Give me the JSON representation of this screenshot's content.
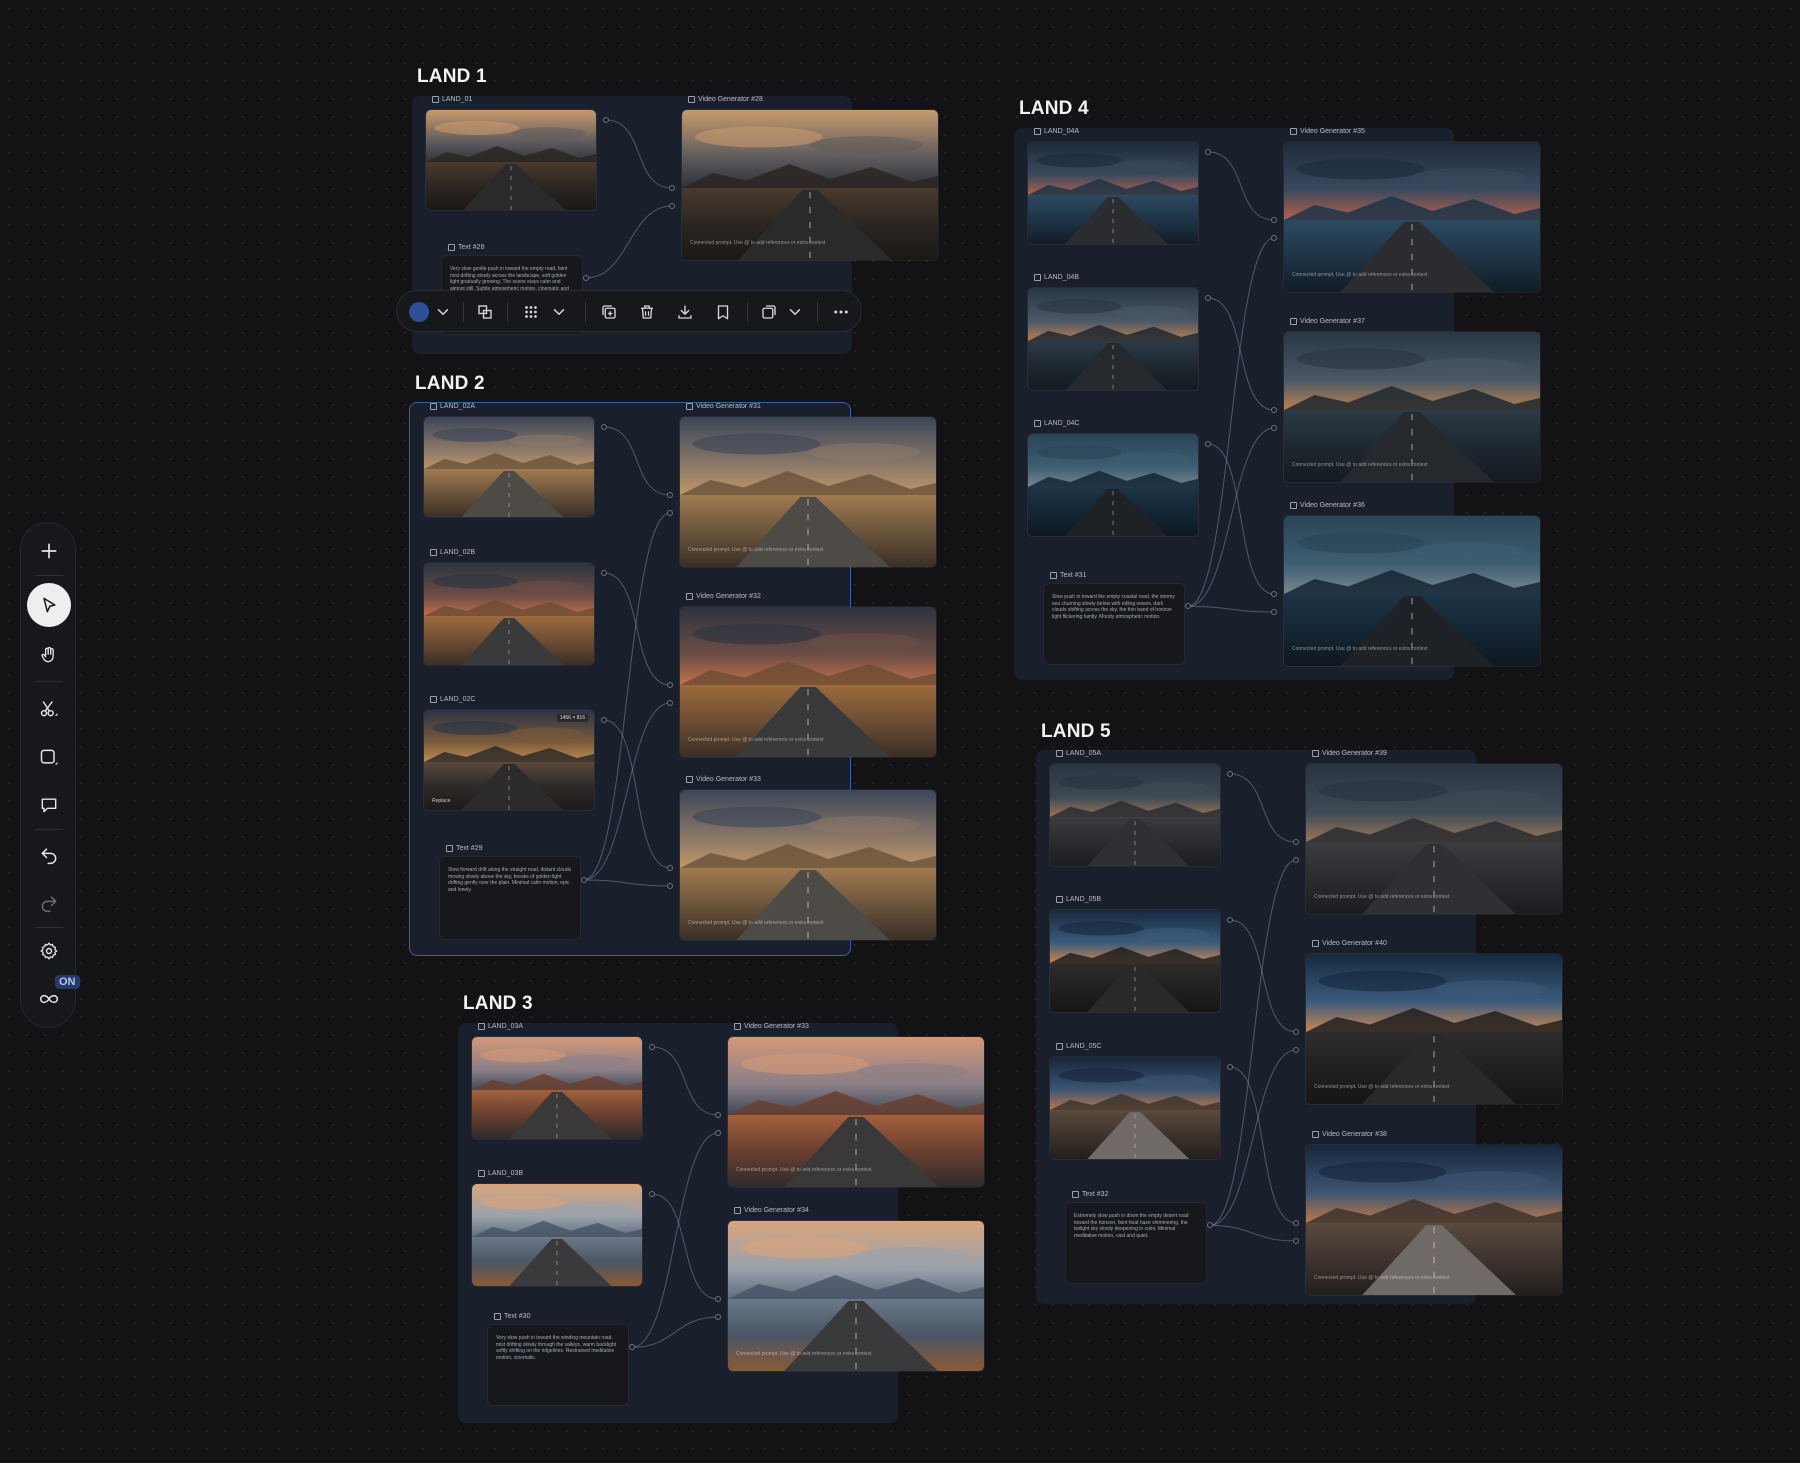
{
  "canvas": {
    "groups": [
      {
        "id": "land1",
        "title": "LAND 1",
        "selected": false,
        "nodes": [
          {
            "id": "l1-img-a",
            "kind": "image",
            "label": "LAND_01",
            "palette": "dusk-road"
          },
          {
            "id": "l1-vid",
            "kind": "video",
            "label": "Video Generator #28",
            "caption": "Connected prompt. Use @ to add references or extra context",
            "palette": "dusk-road"
          },
          {
            "id": "l1-text",
            "kind": "text",
            "label": "Text #28",
            "body": "Very slow gentle push in toward the empty road, faint mist drifting slowly across the landscape, soft golden light gradually growing. The scene stays calm and almost still. Subtle atmospheric motion, cinematic and quiet."
          }
        ]
      },
      {
        "id": "land2",
        "title": "LAND 2",
        "selected": true,
        "nodes": [
          {
            "id": "l2-img-a",
            "kind": "image",
            "label": "LAND_02A",
            "palette": "golden-plain"
          },
          {
            "id": "l2-img-b",
            "kind": "image",
            "label": "LAND_02B",
            "palette": "ember-plain"
          },
          {
            "id": "l2-img-c",
            "kind": "image",
            "label": "LAND_02C",
            "palette": "storm-plain",
            "badge": "1456 × 816",
            "replace": "Replace"
          },
          {
            "id": "l2-vid-a",
            "kind": "video",
            "label": "Video Generator #31",
            "caption": "Connected prompt. Use @ to add references or extra context",
            "palette": "golden-plain"
          },
          {
            "id": "l2-vid-b",
            "kind": "video",
            "label": "Video Generator #32",
            "caption": "Connected prompt. Use @ to add references or extra context",
            "palette": "ember-plain"
          },
          {
            "id": "l2-vid-c",
            "kind": "video",
            "label": "Video Generator #33",
            "caption": "Connected prompt. Use @ to add references or extra context",
            "palette": "golden-plain"
          },
          {
            "id": "l2-text",
            "kind": "text",
            "label": "Text #29",
            "body": "Slow forward drift along the straight road, distant clouds moving slowly above the sky, breaks of golden light drifting gently over the plain. Minimal calm motion, epic and lonely."
          }
        ]
      },
      {
        "id": "land3",
        "title": "LAND 3",
        "selected": false,
        "nodes": [
          {
            "id": "l3-img-a",
            "kind": "image",
            "label": "LAND_03A",
            "palette": "mountain-dusk"
          },
          {
            "id": "l3-img-b",
            "kind": "image",
            "label": "LAND_03B",
            "palette": "misty-hills"
          },
          {
            "id": "l3-vid-a",
            "kind": "video",
            "label": "Video Generator #33",
            "caption": "Connected prompt. Use @ to add references or extra context",
            "palette": "mountain-dusk"
          },
          {
            "id": "l3-vid-b",
            "kind": "video",
            "label": "Video Generator #34",
            "caption": "Connected prompt. Use @ to add references or extra context",
            "palette": "misty-hills"
          },
          {
            "id": "l3-text",
            "kind": "text",
            "label": "Text #30",
            "body": "Very slow push in toward the winding mountain road, mist drifting slowly through the valleys, warm backlight softly shifting on the ridgelines. Restrained meditative motion, cinematic."
          }
        ]
      },
      {
        "id": "land4",
        "title": "LAND 4",
        "selected": false,
        "nodes": [
          {
            "id": "l4-img-a",
            "kind": "image",
            "label": "LAND_04A",
            "palette": "storm-coast"
          },
          {
            "id": "l4-img-b",
            "kind": "image",
            "label": "LAND_04B",
            "palette": "storm-sea"
          },
          {
            "id": "l4-img-c",
            "kind": "image",
            "label": "LAND_04C",
            "palette": "night-coast"
          },
          {
            "id": "l4-vid-a",
            "kind": "video",
            "label": "Video Generator #35",
            "caption": "Connected prompt. Use @ to add references or extra context",
            "palette": "storm-coast"
          },
          {
            "id": "l4-vid-b",
            "kind": "video",
            "label": "Video Generator #37",
            "caption": "Connected prompt. Use @ to add references or extra context",
            "palette": "storm-sea"
          },
          {
            "id": "l4-vid-c",
            "kind": "video",
            "label": "Video Generator #36",
            "caption": "Connected prompt. Use @ to add references or extra context",
            "palette": "night-coast"
          },
          {
            "id": "l4-text",
            "kind": "text",
            "label": "Text #31",
            "body": "Slow push in toward the empty coastal road, the stormy sea churning slowly below with rolling waves, dark clouds shifting across the sky, the thin band of horizon light flickering faintly. Moody atmospheric motion."
          }
        ]
      },
      {
        "id": "land5",
        "title": "LAND 5",
        "selected": false,
        "nodes": [
          {
            "id": "l5-img-a",
            "kind": "image",
            "label": "LAND_05A",
            "palette": "storm-highway"
          },
          {
            "id": "l5-img-b",
            "kind": "image",
            "label": "LAND_05B",
            "palette": "twilight-road"
          },
          {
            "id": "l5-img-c",
            "kind": "image",
            "label": "LAND_05C",
            "palette": "desert-dusk"
          },
          {
            "id": "l5-vid-a",
            "kind": "video",
            "label": "Video Generator #39",
            "caption": "Connected prompt. Use @ to add references or extra context",
            "palette": "storm-highway"
          },
          {
            "id": "l5-vid-b",
            "kind": "video",
            "label": "Video Generator #40",
            "caption": "Connected prompt. Use @ to add references or extra context",
            "palette": "twilight-road"
          },
          {
            "id": "l5-vid-c",
            "kind": "video",
            "label": "Video Generator #38",
            "caption": "Connected prompt. Use @ to add references or extra context",
            "palette": "desert-dusk"
          },
          {
            "id": "l5-text",
            "kind": "text",
            "label": "Text #32",
            "body": "Extremely slow push in down the empty desert road toward the horizon, faint heat haze shimmering, the twilight sky slowly deepening in color. Minimal meditative motion, vast and quiet."
          }
        ]
      }
    ]
  },
  "palettes": {
    "dusk-road": {
      "sky": [
        "#c89a6e",
        "#5d5a5c",
        "#2a2f36"
      ],
      "land": [
        "#4a3a2c",
        "#2b2622",
        "#1a1715"
      ],
      "road": "#2b2a2b"
    },
    "golden-plain": {
      "sky": [
        "#3c4658",
        "#8b7868",
        "#c59866"
      ],
      "land": [
        "#a07a50",
        "#6c553c",
        "#3a2f26"
      ],
      "road": "#4e4a46"
    },
    "ember-plain": {
      "sky": [
        "#2c3340",
        "#6e4e46",
        "#c9734a"
      ],
      "land": [
        "#9c6a3c",
        "#6e4e34",
        "#3a2e24"
      ],
      "road": "#3b3a3a"
    },
    "storm-plain": {
      "sky": [
        "#2a3446",
        "#7b5a3c",
        "#c79452"
      ],
      "land": [
        "#5a4a3c",
        "#2e2a28",
        "#1c1a1a"
      ],
      "road": "#2c2a2a"
    },
    "mountain-dusk": {
      "sky": [
        "#d49978",
        "#8a7e86",
        "#3a4452"
      ],
      "land": [
        "#a4603c",
        "#6a4030",
        "#2e2a2c"
      ],
      "road": "#3a3838"
    },
    "misty-hills": {
      "sky": [
        "#d8a47c",
        "#9aa2ac",
        "#5a6878"
      ],
      "land": [
        "#6a7888",
        "#4a5666",
        "#8a5a36"
      ],
      "road": "#3a3a3c"
    },
    "storm-coast": {
      "sky": [
        "#1e2a3a",
        "#3a4a5e",
        "#c0614a"
      ],
      "land": [
        "#2c4a60",
        "#1e3446",
        "#121c26"
      ],
      "road": "#2a2c30"
    },
    "storm-sea": {
      "sky": [
        "#2a3644",
        "#4a5866",
        "#c4844e"
      ],
      "land": [
        "#2a3a46",
        "#1e2830",
        "#141a20"
      ],
      "road": "#25282c"
    },
    "night-coast": {
      "sky": [
        "#2a4456",
        "#3e5e72",
        "#7c8a92"
      ],
      "land": [
        "#1c3446",
        "#142634",
        "#0e1820"
      ],
      "road": "#1e2226"
    },
    "storm-highway": {
      "sky": [
        "#2a3440",
        "#3e4a56",
        "#a07a58"
      ],
      "land": [
        "#3a3c40",
        "#2a2c30",
        "#1a1c1e"
      ],
      "road": "#2e3034"
    },
    "twilight-road": {
      "sky": [
        "#16283e",
        "#3c5c7c",
        "#d48850"
      ],
      "land": [
        "#2e2c2c",
        "#22201f",
        "#161515"
      ],
      "road": "#2a2828"
    },
    "desert-dusk": {
      "sky": [
        "#16263c",
        "#3e5672",
        "#c87a46"
      ],
      "land": [
        "#5a4a3e",
        "#3e342e",
        "#221e1c"
      ],
      "road": "#706a66"
    }
  },
  "toolbar": {
    "color_swatch": "#2c4f95",
    "buttons": [
      {
        "id": "color-picker",
        "icon": "color-swatch-icon"
      },
      {
        "id": "color-dropdown",
        "icon": "chevron-down-icon"
      },
      {
        "id": "ungroup",
        "icon": "ungroup-icon"
      },
      {
        "id": "layout-grid",
        "icon": "grid-icon"
      },
      {
        "id": "layout-dropdown",
        "icon": "chevron-down-icon"
      },
      {
        "id": "duplicate",
        "icon": "duplicate-icon"
      },
      {
        "id": "delete",
        "icon": "trash-icon"
      },
      {
        "id": "download",
        "icon": "download-icon"
      },
      {
        "id": "bookmark",
        "icon": "bookmark-icon"
      },
      {
        "id": "arrange",
        "icon": "layers-icon"
      },
      {
        "id": "arrange-dropdown",
        "icon": "chevron-down-icon"
      },
      {
        "id": "more",
        "icon": "more-icon"
      }
    ]
  },
  "left_rail": {
    "tools": [
      {
        "id": "add",
        "icon": "plus-icon"
      },
      {
        "id": "select",
        "icon": "cursor-icon",
        "active": true
      },
      {
        "id": "pan",
        "icon": "hand-icon"
      },
      {
        "id": "cut",
        "icon": "scissors-icon"
      },
      {
        "id": "frame",
        "icon": "frame-icon"
      },
      {
        "id": "comment",
        "icon": "comment-icon"
      },
      {
        "id": "undo",
        "icon": "undo-icon"
      },
      {
        "id": "redo",
        "icon": "redo-icon",
        "disabled": true
      },
      {
        "id": "settings",
        "icon": "gear-icon"
      },
      {
        "id": "loop",
        "icon": "infinity-icon"
      }
    ],
    "loop_badge": "ON"
  }
}
